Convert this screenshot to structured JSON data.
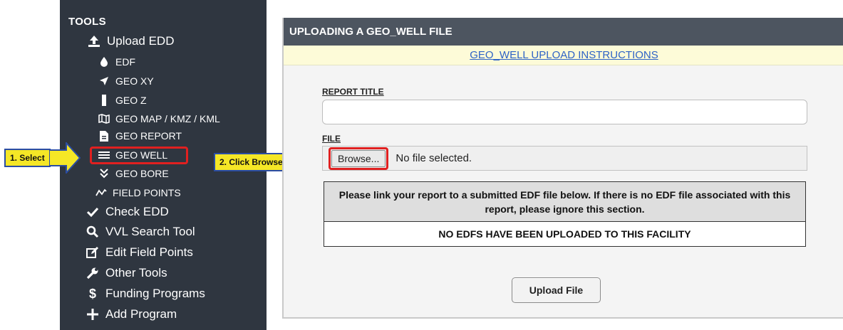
{
  "sidebar": {
    "section_title": "TOOLS",
    "items": {
      "upload_edd": {
        "label": "Upload EDD",
        "icon": "upload-icon"
      },
      "edf": {
        "label": "EDF",
        "icon": "droplet-icon"
      },
      "geo_xy": {
        "label": "GEO XY",
        "icon": "location-arrow-icon"
      },
      "geo_z": {
        "label": "GEO Z",
        "icon": "vertical-bar-icon"
      },
      "geo_map": {
        "label": "GEO MAP / KMZ / KML",
        "icon": "map-icon"
      },
      "geo_report": {
        "label": "GEO REPORT",
        "icon": "file-icon"
      },
      "geo_well": {
        "label": "GEO WELL",
        "icon": "waves-icon"
      },
      "geo_bore": {
        "label": "GEO BORE",
        "icon": "double-chevron-down-icon"
      },
      "field_points": {
        "label": "FIELD POINTS",
        "icon": "zigzag-icon"
      },
      "check_edd": {
        "label": "Check EDD",
        "icon": "check-icon"
      },
      "vvl_search": {
        "label": "VVL Search Tool",
        "icon": "search-icon"
      },
      "edit_field_points": {
        "label": "Edit Field Points",
        "icon": "edit-icon"
      },
      "other_tools": {
        "label": "Other Tools",
        "icon": "wrench-icon"
      },
      "funding_programs": {
        "label": "Funding Programs",
        "icon": "dollar-icon"
      },
      "add_program": {
        "label": "Add Program",
        "icon": "plus-icon"
      }
    }
  },
  "callouts": {
    "step1": "1. Select",
    "step2": "2. Click Browse"
  },
  "panel": {
    "header": "UPLOADING A GEO_WELL FILE",
    "instructions_link": "GEO_WELL UPLOAD INSTRUCTIONS",
    "report_title_label": "REPORT TITLE",
    "report_title_value": "",
    "file_label": "FILE",
    "browse_label": "Browse...",
    "file_status": "No file selected.",
    "link_notice": "Please link your report to a submitted EDF file below. If there is no EDF file associated with this report, please ignore this section.",
    "no_edfs": "NO EDFS HAVE BEEN UPLOADED TO THIS FACILITY",
    "upload_button": "Upload File"
  },
  "colors": {
    "sidebar_bg": "#2f3640",
    "header_bg": "#4d5560",
    "instructions_bg": "#fdfbd8",
    "link": "#2e63c6",
    "highlight_border": "#e02020",
    "callout_fill": "#f5e726",
    "callout_border": "#2b4da3"
  }
}
